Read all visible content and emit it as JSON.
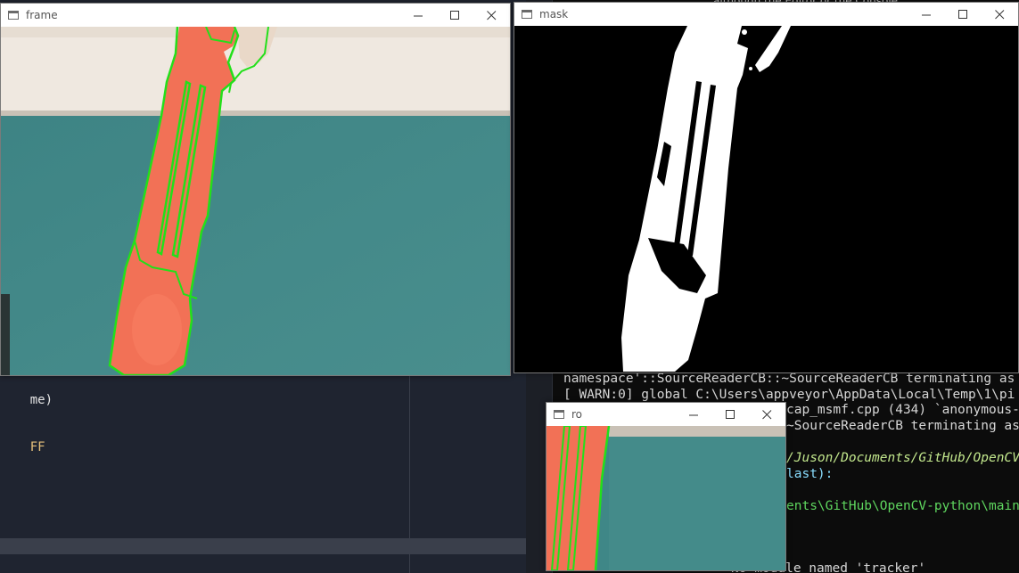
{
  "editor": {
    "lines": [
      {
        "text": "me)",
        "color": "#e6e6e6"
      },
      {
        "text": "FF",
        "color": "#e5c07b"
      }
    ]
  },
  "terminal": {
    "top_text": "although the Editor or the Console",
    "lines": [
      {
        "text": "namespace'::SourceReaderCB::~SourceReaderCB terminating as",
        "color": "#e0e0e0"
      },
      {
        "text": "[ WARN:0] global C:\\Users\\appveyor\\AppData\\Local\\Temp\\1\\pi",
        "color": "#e0e0e0"
      },
      {
        "text": "cap_msmf.cpp (434) `anonymous-",
        "color": "#e0e0e0"
      },
      {
        "text": "~SourceReaderCB terminating as",
        "color": "#e0e0e0"
      },
      {
        "text": "/Juson/Documents/GitHub/OpenCV",
        "color": "#c3e88d"
      },
      {
        "text": "last):",
        "color": "#89ddff"
      },
      {
        "text": "ents\\GitHub\\OpenCV-python\\main",
        "color": "#5fd75f"
      },
      {
        "text": "No module named 'tracker'",
        "color": "#e0e0e0"
      }
    ]
  },
  "windows": {
    "frame": {
      "title": "frame"
    },
    "mask": {
      "title": "mask"
    },
    "roi": {
      "title": "ro"
    }
  },
  "colors": {
    "object_orange": "#f27156",
    "contour_green": "#22e01a",
    "wall_teal": "#3f8787",
    "mask_white": "#ffffff",
    "mask_black": "#000000"
  },
  "icons": {
    "app": "window-app-icon",
    "minimize": "minimize-icon",
    "maximize": "maximize-icon",
    "close": "close-icon"
  }
}
